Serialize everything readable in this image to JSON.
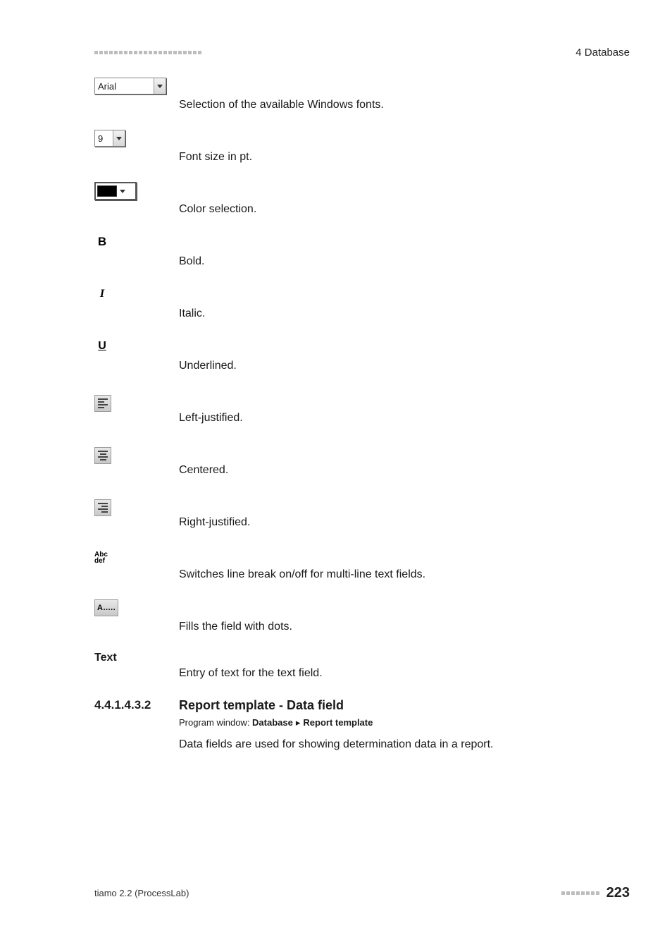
{
  "header": {
    "chapter": "4 Database",
    "square_count": 22
  },
  "rows": [
    {
      "type": "font-dropdown",
      "value": "Arial",
      "desc": "Selection of the available Windows fonts."
    },
    {
      "type": "size-dropdown",
      "value": "9",
      "desc": "Font size in pt."
    },
    {
      "type": "color-dropdown",
      "desc": "Color selection."
    },
    {
      "type": "bold",
      "glyph": "B",
      "desc": "Bold."
    },
    {
      "type": "italic",
      "glyph": "I",
      "desc": "Italic."
    },
    {
      "type": "underline",
      "glyph": "U",
      "desc": "Underlined."
    },
    {
      "type": "align-left",
      "desc": "Left-justified."
    },
    {
      "type": "align-center",
      "desc": "Centered."
    },
    {
      "type": "align-right",
      "desc": "Right-justified."
    },
    {
      "type": "wrap",
      "glyph_top": "Abc",
      "glyph_bottom": "def",
      "desc": "Switches line break on/off for multi-line text fields."
    },
    {
      "type": "fill",
      "glyph": "A.....",
      "desc": "Fills the field with dots."
    },
    {
      "type": "text-label",
      "label": "Text",
      "desc": "Entry of text for the text field."
    }
  ],
  "section": {
    "number": "4.4.1.4.3.2",
    "title": "Report template - Data field",
    "caption_prefix": "Program window: ",
    "caption_path1": "Database",
    "caption_arrow": "▸",
    "caption_path2": "Report template",
    "body": "Data fields are used for showing determination data in a report."
  },
  "footer": {
    "product": "tiamo 2.2 (ProcessLab)",
    "square_count": 8,
    "page": "223"
  }
}
